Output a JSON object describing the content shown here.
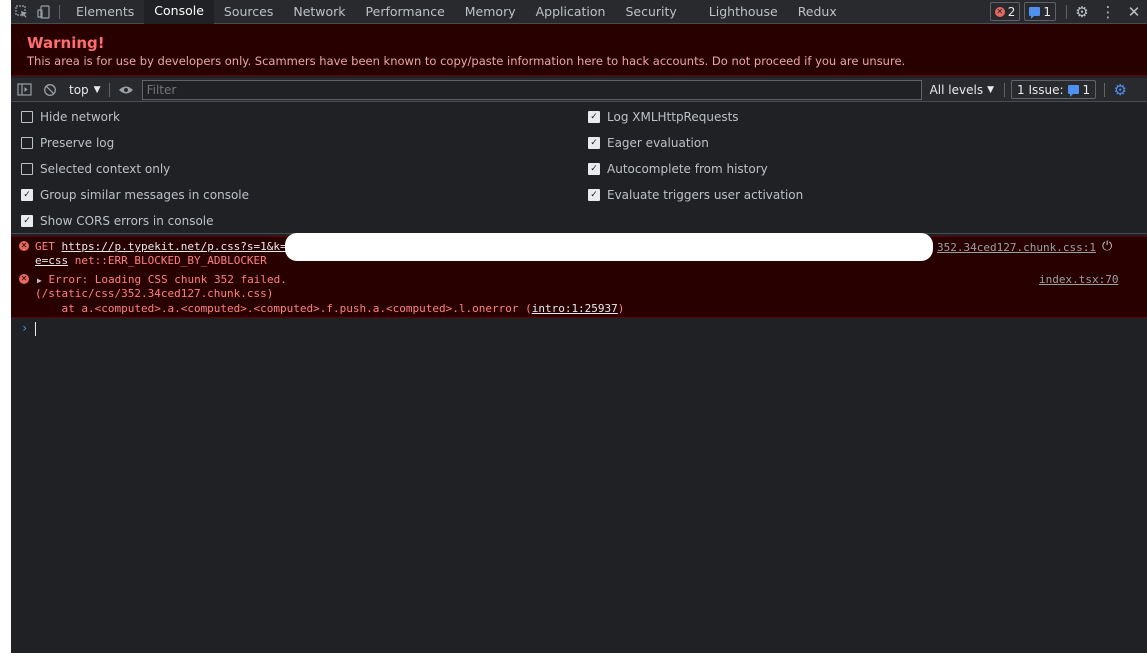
{
  "tabbar": {
    "tabs": [
      "Elements",
      "Console",
      "Sources",
      "Network",
      "Performance",
      "Memory",
      "Application",
      "Security",
      "Lighthouse",
      "Redux"
    ],
    "active": "Console",
    "error_count": "2",
    "issue_count": "1"
  },
  "warning": {
    "title": "Warning!",
    "text": "This area is for use by developers only. Scammers have been known to copy/paste information here to hack accounts. Do not proceed if you are unsure."
  },
  "toolbar": {
    "context": "top",
    "filter_placeholder": "Filter",
    "levels": "All levels",
    "issues_label": "1 Issue:",
    "issues_count": "1"
  },
  "settings": {
    "left": [
      {
        "label": "Hide network",
        "checked": false
      },
      {
        "label": "Preserve log",
        "checked": false
      },
      {
        "label": "Selected context only",
        "checked": false
      },
      {
        "label": "Group similar messages in console",
        "checked": true
      },
      {
        "label": "Show CORS errors in console",
        "checked": true
      }
    ],
    "right": [
      {
        "label": "Log XMLHttpRequests",
        "checked": true
      },
      {
        "label": "Eager evaluation",
        "checked": true
      },
      {
        "label": "Autocomplete from history",
        "checked": true
      },
      {
        "label": "Evaluate triggers user activation",
        "checked": true
      }
    ]
  },
  "messages": {
    "m1": {
      "method": "GET",
      "url": "https://p.typekit.net/p.css?s=1&k=",
      "url_tail": "e=css",
      "error": "net::ERR_BLOCKED_BY_ADBLOCKER",
      "source": "352.34ced127.chunk.css:1"
    },
    "m2": {
      "line1": "Error: Loading CSS chunk 352 failed.",
      "line2": "(/static/css/352.34ced127.chunk.css)",
      "line3_prefix": "    at a.<computed>.a.<computed>.<computed>.f.push.a.<computed>.l.onerror (",
      "line3_link": "intro:1:25937",
      "line3_suffix": ")",
      "source": "index.tsx:70"
    }
  },
  "colors": {
    "panel": "#202124",
    "error_bg": "#290000",
    "error_text": "#ff8080",
    "accent": "#4f8ff0"
  }
}
